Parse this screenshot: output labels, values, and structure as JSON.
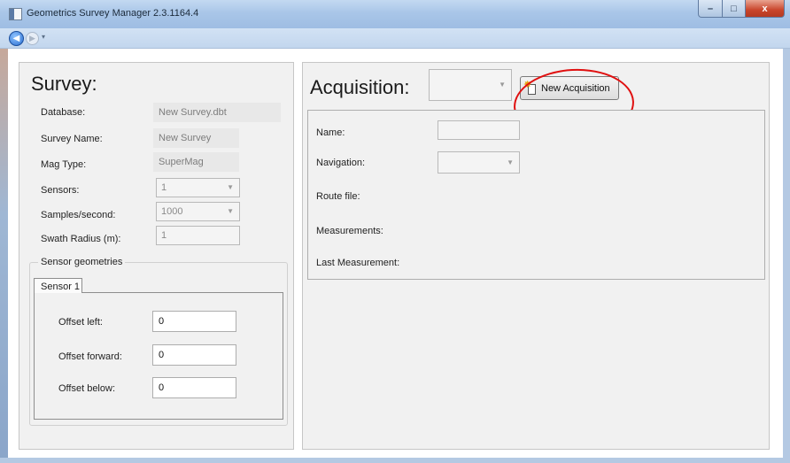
{
  "window": {
    "title": "Geometrics Survey Manager 2.3.1164.4",
    "controls": {
      "minimize": "–",
      "maximize": "□",
      "close": "x"
    }
  },
  "nav": {
    "back_icon": "◀",
    "forward_icon": "▶",
    "dropdown_icon": "▾"
  },
  "survey": {
    "heading": "Survey:",
    "database_label": "Database:",
    "database_value": "New Survey.dbt",
    "survey_name_label": "Survey Name:",
    "survey_name_value": "New Survey",
    "mag_type_label": "Mag Type:",
    "mag_type_value": "SuperMag",
    "sensors_label": "Sensors:",
    "sensors_value": "1",
    "samples_label": "Samples/second:",
    "samples_value": "1000",
    "swath_label": "Swath Radius (m):",
    "swath_value": "1",
    "geometries": {
      "legend": "Sensor geometries",
      "tab_label": "Sensor 1",
      "offset_left_label": "Offset left:",
      "offset_left_value": "0",
      "offset_forward_label": "Offset forward:",
      "offset_forward_value": "0",
      "offset_below_label": "Offset below:",
      "offset_below_value": "0"
    }
  },
  "acquisition": {
    "heading": "Acquisition:",
    "selector_value": "",
    "new_button_label": "New Acquisition",
    "name_label": "Name:",
    "name_value": "",
    "navigation_label": "Navigation:",
    "navigation_value": "",
    "route_file_label": "Route file:",
    "measurements_label": "Measurements:",
    "last_measurement_label": "Last Measurement:"
  },
  "colors": {
    "annotation": "#e01010",
    "panel_bg": "#f1f1f1",
    "titlebar": "#a9c6e8"
  }
}
